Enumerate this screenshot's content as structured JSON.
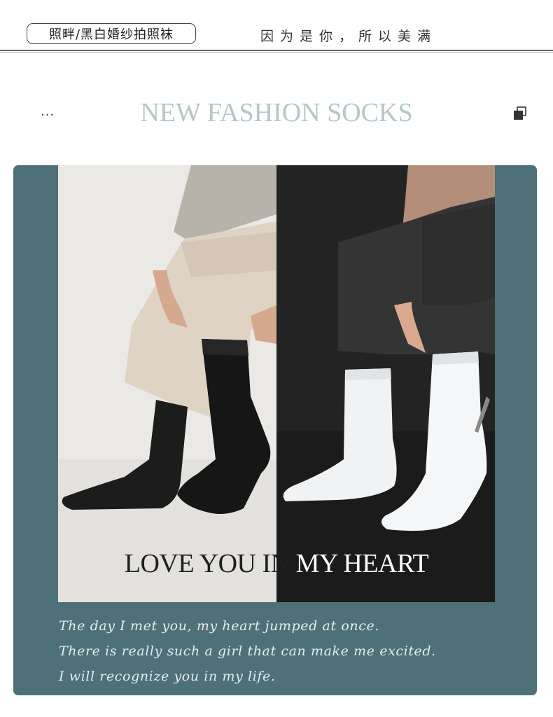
{
  "header": {
    "badge_text": "照畔/黑白婚纱拍照袜",
    "slogan": "因为是你，所以美满"
  },
  "section": {
    "menu_glyph": "···",
    "title": "NEW FASHION SOCKS",
    "right_icon": "copy-icon"
  },
  "photo": {
    "left_description_icon": "black-sock-photo",
    "right_description_icon": "white-sock-photo",
    "headline_left": "LOVE YOU IN ",
    "headline_right": "MY HEART"
  },
  "caption": {
    "lines": [
      "The day I met you, my heart jumped at once.",
      "There is really such a girl that can make me excited.",
      "I will recognize you in my life."
    ]
  },
  "colors": {
    "panel": "#4e7179",
    "title": "#b7c6c8"
  }
}
